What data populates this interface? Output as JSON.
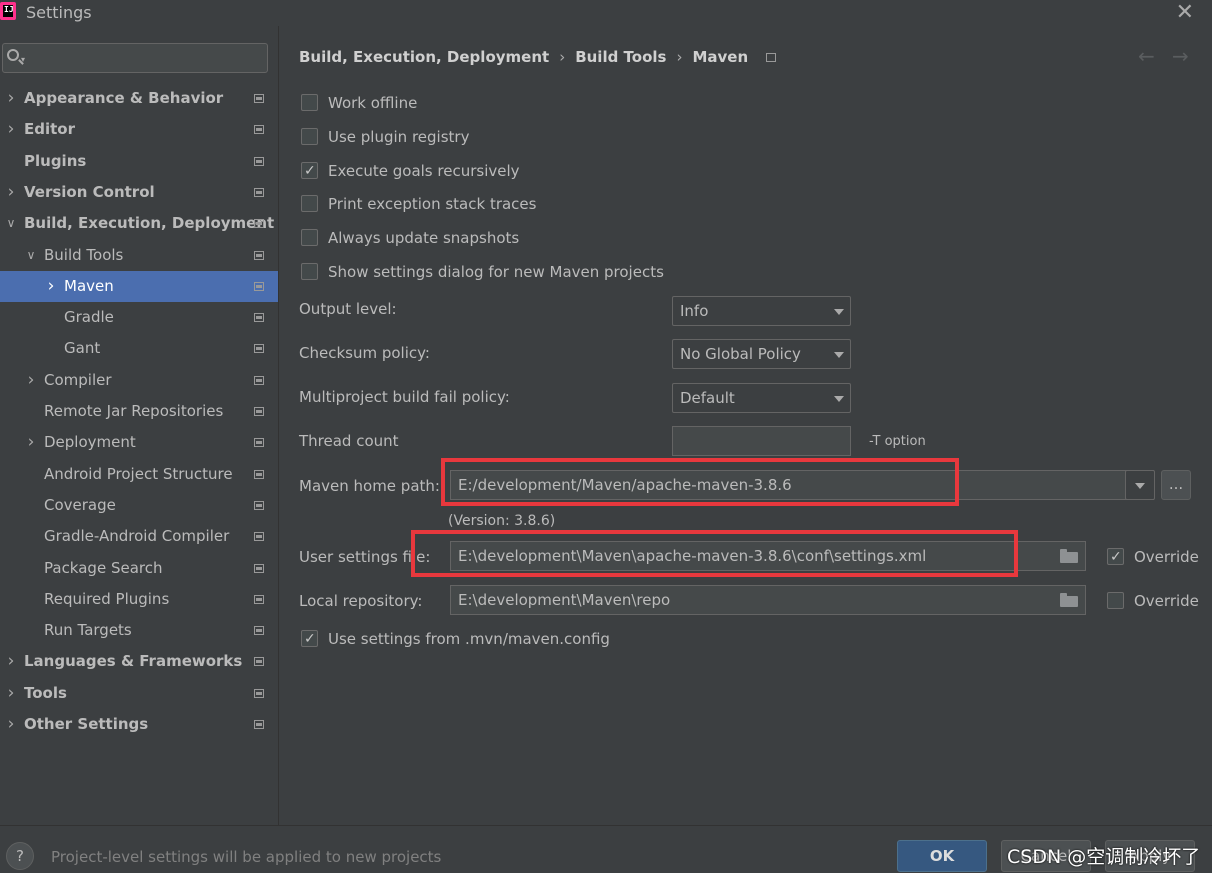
{
  "window": {
    "title": "Settings",
    "logo_text": "IJ"
  },
  "sidebar": {
    "search_placeholder": "",
    "items": [
      {
        "label": "Appearance & Behavior",
        "expandable": true,
        "expanded": false
      },
      {
        "label": "Editor",
        "expandable": true,
        "expanded": false
      },
      {
        "label": "Plugins",
        "expandable": false
      },
      {
        "label": "Version Control",
        "expandable": true,
        "expanded": false
      },
      {
        "label": "Build, Execution, Deployment",
        "expandable": true,
        "expanded": true
      },
      {
        "label": "Build Tools",
        "expandable": true,
        "expanded": true
      },
      {
        "label": "Maven",
        "expandable": true,
        "expanded": false,
        "selected": true
      },
      {
        "label": "Gradle"
      },
      {
        "label": "Gant"
      },
      {
        "label": "Compiler",
        "expandable": true
      },
      {
        "label": "Remote Jar Repositories"
      },
      {
        "label": "Deployment",
        "expandable": true
      },
      {
        "label": "Android Project Structure"
      },
      {
        "label": "Coverage"
      },
      {
        "label": "Gradle-Android Compiler"
      },
      {
        "label": "Package Search"
      },
      {
        "label": "Required Plugins"
      },
      {
        "label": "Run Targets"
      },
      {
        "label": "Languages & Frameworks",
        "expandable": true
      },
      {
        "label": "Tools",
        "expandable": true
      },
      {
        "label": "Other Settings",
        "expandable": true
      }
    ]
  },
  "breadcrumb": {
    "parts": [
      "Build, Execution, Deployment",
      "Build Tools",
      "Maven"
    ],
    "separator": "›"
  },
  "nav": {
    "back": "←",
    "forward": "→"
  },
  "checkboxes": [
    {
      "label": "Work offline",
      "checked": false
    },
    {
      "label": "Use plugin registry",
      "checked": false
    },
    {
      "label": "Execute goals recursively",
      "checked": true
    },
    {
      "label": "Print exception stack traces",
      "checked": false
    },
    {
      "label": "Always update snapshots",
      "checked": false
    },
    {
      "label": "Show settings dialog for new Maven projects",
      "checked": false
    }
  ],
  "fields": {
    "output_level": {
      "label": "Output level:",
      "value": "Info"
    },
    "checksum_policy": {
      "label": "Checksum policy:",
      "value": "No Global Policy"
    },
    "fail_policy": {
      "label": "Multiproject build fail policy:",
      "value": "Default"
    },
    "thread_count": {
      "label": "Thread count",
      "value": "",
      "suffix": "-T option"
    },
    "maven_home": {
      "label": "Maven home path:",
      "value": "E:/development/Maven/apache-maven-3.8.6",
      "version": "(Version: 3.8.6)",
      "browse": "..."
    },
    "user_settings": {
      "label": "User settings file:",
      "value": "E:\\development\\Maven\\apache-maven-3.8.6\\conf\\settings.xml",
      "override_label": "Override",
      "override": true
    },
    "local_repo": {
      "label": "Local repository:",
      "value": "E:\\development\\Maven\\repo",
      "override_label": "Override",
      "override": false
    },
    "use_mvn_config": {
      "label": "Use settings from .mvn/maven.config",
      "checked": true
    }
  },
  "footer": {
    "help": "?",
    "text": "Project-level settings will be applied to new projects",
    "ok": "OK",
    "cancel": "Cancel",
    "apply": "Apply",
    "watermark": "CSDN @空调制冷坏了"
  },
  "colors": {
    "selection": "#4b6eaf",
    "highlight": "#e8383d",
    "ok_button": "#365880"
  }
}
